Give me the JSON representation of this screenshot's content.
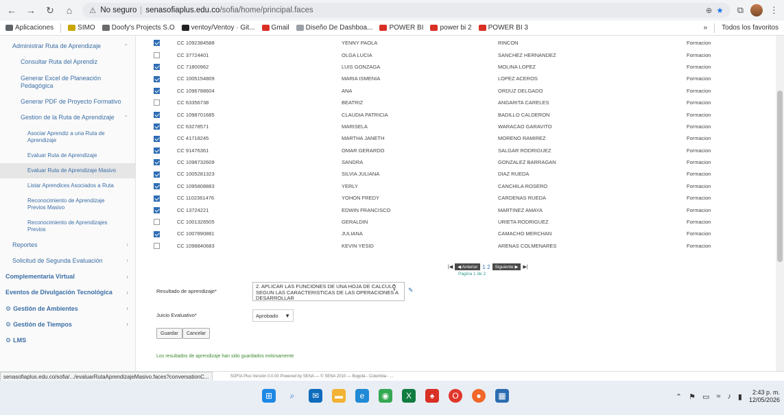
{
  "browser": {
    "security_label": "No seguro",
    "url_host": "senasofiaplus.edu.co",
    "url_path": "/sofia/home/principal.faces",
    "more_label": "»",
    "all_bookmarks": "Todos los favoritos"
  },
  "bookmarks": [
    {
      "label": "Aplicaciones",
      "color": "#5f6368"
    },
    {
      "label": "SIMO",
      "color": "#c8a600"
    },
    {
      "label": "Doofy's Projects S.O",
      "color": "#6a6a6a"
    },
    {
      "label": "ventoy/Ventoy · Git...",
      "color": "#222222"
    },
    {
      "label": "Gmail",
      "color": "#d93025"
    },
    {
      "label": "Diseño De Dashboa...",
      "color": "#9aa0a6"
    },
    {
      "label": "POWER BI",
      "color": "#d93025"
    },
    {
      "label": "power bi 2",
      "color": "#d93025"
    },
    {
      "label": "POWER BI 3",
      "color": "#d93025"
    }
  ],
  "sidebar": {
    "items": [
      {
        "label": "Administrar Ruta de Aprendizaje",
        "level": "lvl1",
        "chevron": "⌃",
        "active": false
      },
      {
        "label": "Consultar Ruta del Aprendiz",
        "level": "lvl2",
        "chevron": "",
        "active": false
      },
      {
        "label": "Generar Excel de Planeación Pedagógica",
        "level": "lvl2",
        "chevron": "",
        "active": false
      },
      {
        "label": "Generar PDF de Proyecto Formativo",
        "level": "lvl2",
        "chevron": "",
        "active": false
      },
      {
        "label": "Gestion de la Ruta de Aprendizaje",
        "level": "lvl2",
        "chevron": "⌃",
        "active": false
      },
      {
        "label": "Asociar Aprendiz a una Ruta de Aprendizaje",
        "level": "lvl3",
        "chevron": "",
        "active": false
      },
      {
        "label": "Evaluar Ruta de Aprendizaje",
        "level": "lvl3",
        "chevron": "",
        "active": false
      },
      {
        "label": "Evaluar Ruta de Aprendizaje Masivo",
        "level": "lvl3",
        "chevron": "",
        "active": true
      },
      {
        "label": "Listar Aprendices Asociados a Ruta",
        "level": "lvl3",
        "chevron": "",
        "active": false
      },
      {
        "label": "Reconocimiento de Aprendizaje Previos Masivo",
        "level": "lvl3",
        "chevron": "",
        "active": false
      },
      {
        "label": "Reconocimiento de Aprendizajes Previos",
        "level": "lvl3",
        "chevron": "",
        "active": false
      },
      {
        "label": "Reportes",
        "level": "lvl1",
        "chevron": "›",
        "active": false
      },
      {
        "label": "Solicitud de Segunda Evaluación",
        "level": "lvl1",
        "chevron": "›",
        "active": false
      },
      {
        "label": "Complementaria Virtual",
        "level": "top",
        "chevron": "›",
        "active": false
      },
      {
        "label": "Eventos de Divulgación Tecnológica",
        "level": "top",
        "chevron": "›",
        "active": false
      },
      {
        "label": "Gestión de Ambientes",
        "level": "top",
        "chevron": "›",
        "active": false,
        "gear": true
      },
      {
        "label": "Gestión de Tiempos",
        "level": "top",
        "chevron": "›",
        "active": false,
        "gear": true
      },
      {
        "label": "LMS",
        "level": "top",
        "chevron": "",
        "active": false,
        "gear": true
      }
    ]
  },
  "rows": [
    {
      "checked": true,
      "doc": "CC 1092384588",
      "name": "YENNY PAOLA",
      "last": "RINCON",
      "status": "Formacion"
    },
    {
      "checked": false,
      "doc": "CC 37724401",
      "name": "OLGA LUCIA",
      "last": "SANCHEZ HERNANDEZ",
      "status": "Formacion"
    },
    {
      "checked": true,
      "doc": "CC 71800962",
      "name": "LUIS GONZAGA",
      "last": "MOLINA LOPEZ",
      "status": "Formacion"
    },
    {
      "checked": true,
      "doc": "CC 1005154809",
      "name": "MARIA ISMENIA",
      "last": "LOPEZ ACEROS",
      "status": "Formacion"
    },
    {
      "checked": true,
      "doc": "CC 1096788604",
      "name": "ANA",
      "last": "ORDUZ DELGADO",
      "status": "Formacion"
    },
    {
      "checked": false,
      "doc": "CC 63356738",
      "name": "BEATRIZ",
      "last": "ANGARITA CARELES",
      "status": "Formacion"
    },
    {
      "checked": true,
      "doc": "CC 1098701685",
      "name": "CLAUDIA PATRICIA",
      "last": "BADILLO CALDERON",
      "status": "Formacion"
    },
    {
      "checked": true,
      "doc": "CC 63278571",
      "name": "MARISELA",
      "last": "WARACAO GARAVITO",
      "status": "Formacion"
    },
    {
      "checked": true,
      "doc": "CC 41718245",
      "name": "MARTHA JANETH",
      "last": "MORENO RAMIREZ",
      "status": "Formacion"
    },
    {
      "checked": true,
      "doc": "CC 91476361",
      "name": "OMAR GERARDO",
      "last": "SALGAR RODRIGUEZ",
      "status": "Formacion"
    },
    {
      "checked": true,
      "doc": "CC 1098732609",
      "name": "SANDRA",
      "last": "GONZALEZ BARRAGAN",
      "status": "Formacion"
    },
    {
      "checked": true,
      "doc": "CC 1005281323",
      "name": "SILVIA JULIANA",
      "last": "DIAZ RUEDA",
      "status": "Formacion"
    },
    {
      "checked": true,
      "doc": "CC 1095808883",
      "name": "YERLY",
      "last": "CANCHILA ROSERO",
      "status": "Formacion"
    },
    {
      "checked": true,
      "doc": "CC 1102361476",
      "name": "YOHON FREDY",
      "last": "CARDENAS RUEDA",
      "status": "Formacion"
    },
    {
      "checked": true,
      "doc": "CC 13724221",
      "name": "EDWIN FRANCISCO",
      "last": "MARTINEZ AMAYA",
      "status": "Formacion"
    },
    {
      "checked": false,
      "doc": "CC 1001326505",
      "name": "GERALDIN",
      "last": "URIETA RODRIGUEZ",
      "status": "Formacion"
    },
    {
      "checked": true,
      "doc": "CC 1007890881",
      "name": "JULIANA",
      "last": "CAMACHO MERCHAN",
      "status": "Formacion"
    },
    {
      "checked": false,
      "doc": "CC 1098840683",
      "name": "KEVIN YESID",
      "last": "ARENAS COLMENARES",
      "status": "Formacion"
    }
  ],
  "pager": {
    "first": "|◀",
    "prev": "◀ Anterior",
    "pages": "1 2",
    "next": "Siguiente ▶",
    "last": "▶|",
    "info": "Página 1 de 2"
  },
  "form": {
    "result_label": "Resultado de aprendizaje*",
    "result_value": "2. APLICAR LAS FUNCIONES DE UNA HOJA DE CALCULO SEGUN LAS CARACTERISTICAS DE LAS OPERACIONES A DESARROLLAR",
    "judgment_label": "Juicio Evaluativo*",
    "judgment_value": "Aprobado",
    "save_label": "Guardar",
    "cancel_label": "Cancelar",
    "success_message": "Los resultados de aprendizaje han sido guardados exitosamente"
  },
  "status": {
    "link": "senasofiaplus.edu.co/sofia/.../evaluarRutaAprendizajeMasivo.faces?conversationC...",
    "footer": "SOFIA Plus Versión 0.0.00 Powered by SENA — © SENA 2010 — Bogotá - Colombia - ..."
  },
  "taskbar": {
    "time": "2:43 p. m.",
    "date": "12/05/2026"
  }
}
